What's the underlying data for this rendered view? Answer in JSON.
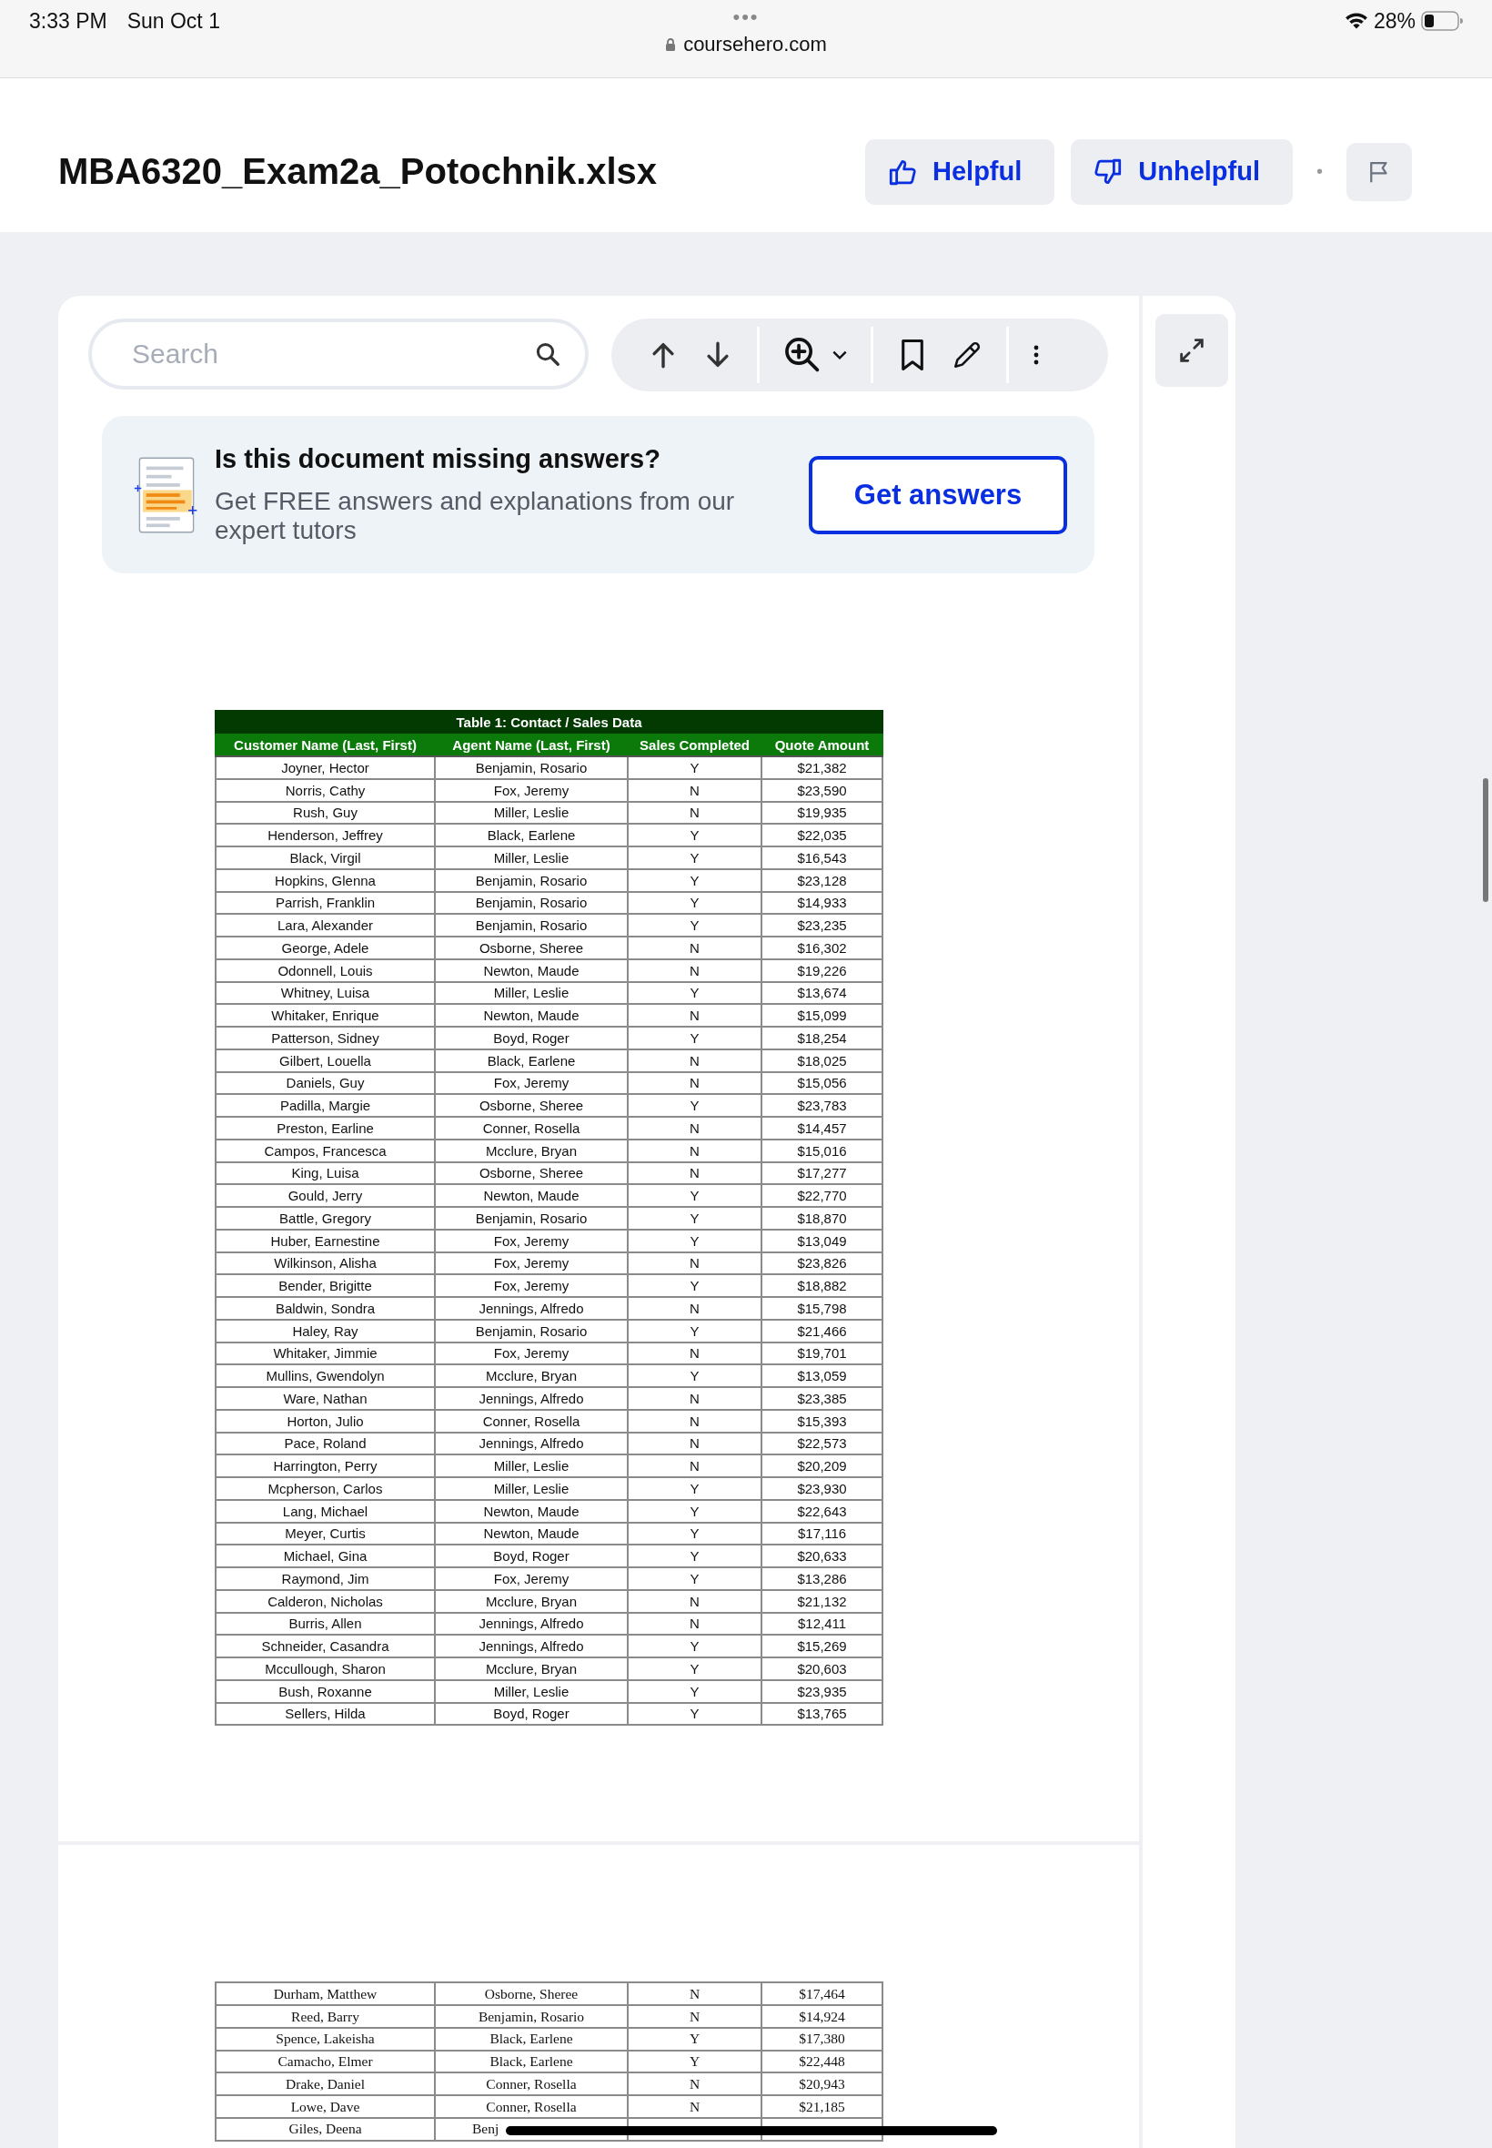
{
  "status_bar": {
    "time": "3:33 PM",
    "date": "Sun Oct 1",
    "dots": "•••",
    "url": "coursehero.com",
    "battery": "28%"
  },
  "header": {
    "title": "MBA6320_Exam2a_Potochnik.xlsx",
    "buttons": [
      {
        "kind": "up",
        "label": "Helpful"
      },
      {
        "kind": "down",
        "label": "Unhelpful"
      }
    ],
    "separator": "•"
  },
  "toolbar": {
    "search": {
      "placeholder": "Search"
    }
  },
  "banner": {
    "title": "Is this document missing answers?",
    "text": "Get FREE answers and explanations from our expert tutors",
    "button": "Get answers"
  },
  "pages": [
    {
      "table": {
        "title": "Table 1: Contact / Sales Data",
        "columns": [
          "Customer Name (Last, First)",
          "Agent Name  (Last, First)",
          "Sales Completed",
          "Quote Amount"
        ],
        "rows": [
          [
            "Joyner, Hector",
            "Benjamin, Rosario",
            "Y",
            "$21,382"
          ],
          [
            "Norris, Cathy",
            "Fox, Jeremy",
            "N",
            "$23,590"
          ],
          [
            "Rush, Guy",
            "Miller, Leslie",
            "N",
            "$19,935"
          ],
          [
            "Henderson, Jeffrey",
            "Black, Earlene",
            "Y",
            "$22,035"
          ],
          [
            "Black, Virgil",
            "Miller, Leslie",
            "Y",
            "$16,543"
          ],
          [
            "Hopkins, Glenna",
            "Benjamin, Rosario",
            "Y",
            "$23,128"
          ],
          [
            "Parrish, Franklin",
            "Benjamin, Rosario",
            "Y",
            "$14,933"
          ],
          [
            "Lara, Alexander",
            "Benjamin, Rosario",
            "Y",
            "$23,235"
          ],
          [
            "George, Adele",
            "Osborne, Sheree",
            "N",
            "$16,302"
          ],
          [
            "Odonnell, Louis",
            "Newton, Maude",
            "N",
            "$19,226"
          ],
          [
            "Whitney, Luisa",
            "Miller, Leslie",
            "Y",
            "$13,674"
          ],
          [
            "Whitaker, Enrique",
            "Newton, Maude",
            "N",
            "$15,099"
          ],
          [
            "Patterson, Sidney",
            "Boyd, Roger",
            "Y",
            "$18,254"
          ],
          [
            "Gilbert, Louella",
            "Black, Earlene",
            "N",
            "$18,025"
          ],
          [
            "Daniels, Guy",
            "Fox, Jeremy",
            "N",
            "$15,056"
          ],
          [
            "Padilla, Margie",
            "Osborne, Sheree",
            "Y",
            "$23,783"
          ],
          [
            "Preston, Earline",
            "Conner, Rosella",
            "N",
            "$14,457"
          ],
          [
            "Campos, Francesca",
            "Mcclure, Bryan",
            "N",
            "$15,016"
          ],
          [
            "King, Luisa",
            "Osborne, Sheree",
            "N",
            "$17,277"
          ],
          [
            "Gould, Jerry",
            "Newton, Maude",
            "Y",
            "$22,770"
          ],
          [
            "Battle, Gregory",
            "Benjamin, Rosario",
            "Y",
            "$18,870"
          ],
          [
            "Huber, Earnestine",
            "Fox, Jeremy",
            "Y",
            "$13,049"
          ],
          [
            "Wilkinson, Alisha",
            "Fox, Jeremy",
            "N",
            "$23,826"
          ],
          [
            "Bender, Brigitte",
            "Fox, Jeremy",
            "Y",
            "$18,882"
          ],
          [
            "Baldwin, Sondra",
            "Jennings, Alfredo",
            "N",
            "$15,798"
          ],
          [
            "Haley, Ray",
            "Benjamin, Rosario",
            "Y",
            "$21,466"
          ],
          [
            "Whitaker, Jimmie",
            "Fox, Jeremy",
            "N",
            "$19,701"
          ],
          [
            "Mullins, Gwendolyn",
            "Mcclure, Bryan",
            "Y",
            "$13,059"
          ],
          [
            "Ware, Nathan",
            "Jennings, Alfredo",
            "N",
            "$23,385"
          ],
          [
            "Horton, Julio",
            "Conner, Rosella",
            "N",
            "$15,393"
          ],
          [
            "Pace, Roland",
            "Jennings, Alfredo",
            "N",
            "$22,573"
          ],
          [
            "Harrington, Perry",
            "Miller, Leslie",
            "N",
            "$20,209"
          ],
          [
            "Mcpherson, Carlos",
            "Miller, Leslie",
            "Y",
            "$23,930"
          ],
          [
            "Lang, Michael",
            "Newton, Maude",
            "Y",
            "$22,643"
          ],
          [
            "Meyer, Curtis",
            "Newton, Maude",
            "Y",
            "$17,116"
          ],
          [
            "Michael, Gina",
            "Boyd, Roger",
            "Y",
            "$20,633"
          ],
          [
            "Raymond, Jim",
            "Fox, Jeremy",
            "Y",
            "$13,286"
          ],
          [
            "Calderon, Nicholas",
            "Mcclure, Bryan",
            "N",
            "$21,132"
          ],
          [
            "Burris, Allen",
            "Jennings, Alfredo",
            "N",
            "$12,411"
          ],
          [
            "Schneider, Casandra",
            "Jennings, Alfredo",
            "Y",
            "$15,269"
          ],
          [
            "Mccullough, Sharon",
            "Mcclure, Bryan",
            "Y",
            "$20,603"
          ],
          [
            "Bush, Roxanne",
            "Miller, Leslie",
            "Y",
            "$23,935"
          ],
          [
            "Sellers, Hilda",
            "Boyd, Roger",
            "Y",
            "$13,765"
          ]
        ]
      }
    },
    {
      "table": {
        "rows": [
          [
            "Durham, Matthew",
            "Osborne, Sheree",
            "N",
            "$17,464"
          ],
          [
            "Reed, Barry",
            "Benjamin, Rosario",
            "N",
            "$14,924"
          ],
          [
            "Spence, Lakeisha",
            "Black, Earlene",
            "Y",
            "$17,380"
          ],
          [
            "Camacho, Elmer",
            "Black, Earlene",
            "Y",
            "$22,448"
          ],
          [
            "Drake, Daniel",
            "Conner, Rosella",
            "N",
            "$20,943"
          ],
          [
            "Lowe, Dave",
            "Conner, Rosella",
            "N",
            "$21,185"
          ],
          [
            "Giles, Deena",
            "Benj"
          ]
        ]
      }
    }
  ]
}
